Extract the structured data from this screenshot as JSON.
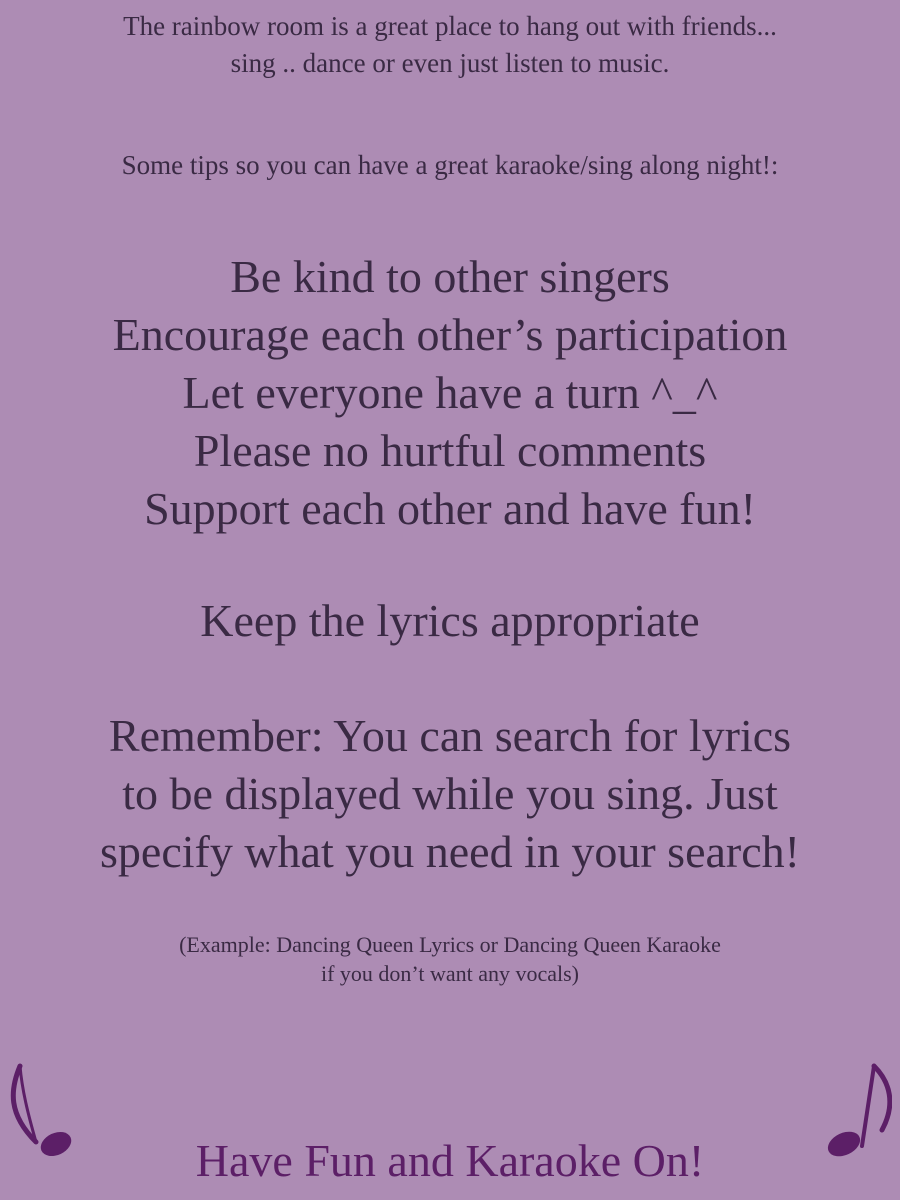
{
  "intro": {
    "line1": "The rainbow room is a great place to hang out with friends...",
    "line2": "sing .. dance or even just listen to music."
  },
  "tips_heading": "Some tips so you can have a great karaoke/sing along night!:",
  "rules": [
    "Be kind to other singers",
    "Encourage each other’s participation",
    "Let everyone have a turn ^_^",
    "Please no hurtful comments",
    "Support each other and have fun!"
  ],
  "lyrics_rule": "Keep the lyrics appropriate",
  "reminder": {
    "line1": "Remember: You can search for lyrics",
    "line2": "to be displayed while you sing.  Just",
    "line3": "specify what you need in your search!"
  },
  "example": {
    "line1": "(Example: Dancing Queen Lyrics or  Dancing Queen Karaoke",
    "line2": "if you don’t want any vocals)"
  },
  "closing": "Have Fun and Karaoke On!",
  "decorations": {
    "left_icon": "music-note-icon",
    "right_icon": "music-note-icon",
    "note_color": "#5c1f67",
    "background_color": "#ad8cb4",
    "text_color": "#3a2a44"
  }
}
